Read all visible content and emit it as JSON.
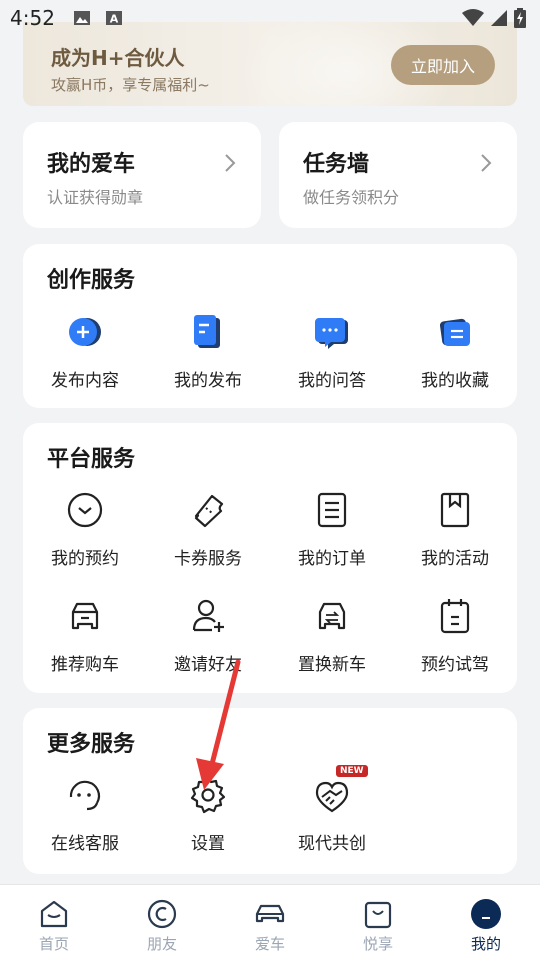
{
  "status_bar": {
    "time": "4:52"
  },
  "banner": {
    "title": "成为H+合伙人",
    "subtitle": "攻赢H币，享专属福利~",
    "button": "立即加入"
  },
  "cards": {
    "my_car": {
      "title": "我的爱车",
      "subtitle": "认证获得勋章"
    },
    "tasks": {
      "title": "任务墙",
      "subtitle": "做任务领积分"
    }
  },
  "creation": {
    "title": "创作服务",
    "items": [
      {
        "label": "发布内容",
        "icon": "publish-plus-icon"
      },
      {
        "label": "我的发布",
        "icon": "my-posts-icon"
      },
      {
        "label": "我的问答",
        "icon": "qa-chat-icon"
      },
      {
        "label": "我的收藏",
        "icon": "favorites-icon"
      }
    ]
  },
  "platform": {
    "title": "平台服务",
    "items": [
      {
        "label": "我的预约",
        "icon": "appointment-icon"
      },
      {
        "label": "卡券服务",
        "icon": "coupon-icon"
      },
      {
        "label": "我的订单",
        "icon": "order-icon"
      },
      {
        "label": "我的活动",
        "icon": "bookmark-icon"
      },
      {
        "label": "推荐购车",
        "icon": "car-recommend-icon"
      },
      {
        "label": "邀请好友",
        "icon": "invite-friend-icon"
      },
      {
        "label": "置换新车",
        "icon": "car-exchange-icon"
      },
      {
        "label": "预约试驾",
        "icon": "calendar-icon"
      }
    ]
  },
  "more": {
    "title": "更多服务",
    "items": [
      {
        "label": "在线客服",
        "icon": "customer-service-icon"
      },
      {
        "label": "设置",
        "icon": "gear-icon"
      },
      {
        "label": "现代共创",
        "icon": "handshake-icon",
        "badge": "NEW"
      }
    ]
  },
  "bottom_nav": {
    "items": [
      {
        "label": "首页",
        "icon": "home-icon",
        "active": false
      },
      {
        "label": "朋友",
        "icon": "friends-icon",
        "active": false
      },
      {
        "label": "爱车",
        "icon": "car-icon",
        "active": false
      },
      {
        "label": "悦享",
        "icon": "shop-bag-icon",
        "active": false
      },
      {
        "label": "我的",
        "icon": "profile-icon",
        "active": true
      }
    ]
  },
  "colors": {
    "accent_blue": "#2f7cf6",
    "navy": "#0b2a55",
    "gold_button": "#b59f7e",
    "annotation_red": "#e53935"
  }
}
